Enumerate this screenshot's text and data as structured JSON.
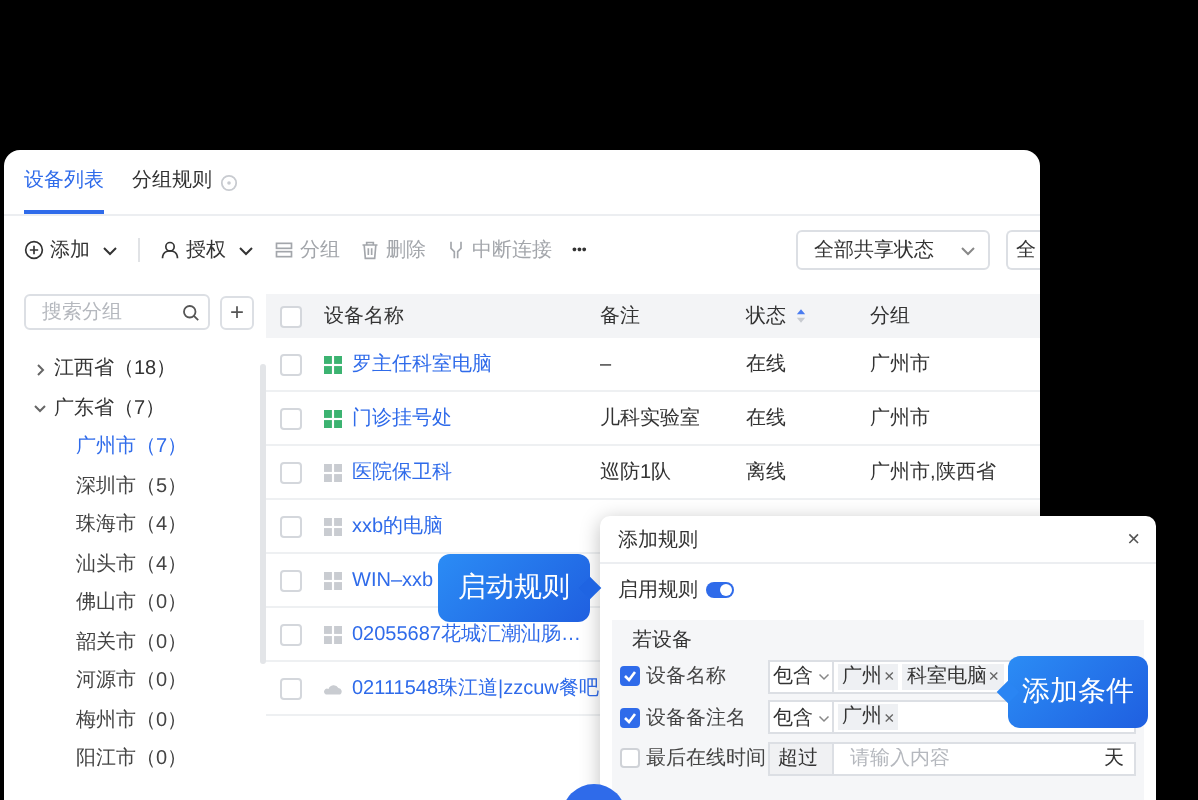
{
  "tabs": [
    {
      "label": "设备列表",
      "selected": true
    },
    {
      "label": "分组规则",
      "selected": false
    }
  ],
  "toolbar": [
    {
      "label": "添加",
      "kind": "add",
      "disabled": false,
      "caret": true
    },
    {
      "label": "授权",
      "kind": "user",
      "disabled": false,
      "caret": true
    },
    {
      "label": "分组",
      "kind": "group",
      "disabled": true,
      "caret": false
    },
    {
      "label": "删除",
      "kind": "delete",
      "disabled": true,
      "caret": false
    },
    {
      "label": "中断连接",
      "kind": "disconnect",
      "disabled": true,
      "caret": false
    },
    {
      "label": "•••",
      "kind": "more",
      "disabled": false,
      "caret": false
    }
  ],
  "filters": [
    "全部共享状态",
    "全"
  ],
  "sidebar": {
    "search_placeholder": "搜索分组",
    "add_label": "+",
    "tree": [
      {
        "label": "江西省（18）",
        "expanded": false
      },
      {
        "label": "广东省（7）",
        "expanded": true,
        "children": [
          {
            "label": "广州市（7）",
            "selected": true
          },
          {
            "label": "深圳市（5）",
            "selected": false
          },
          {
            "label": "珠海市（4）",
            "selected": false
          },
          {
            "label": "汕头市（4）",
            "selected": false
          },
          {
            "label": "佛山市（0）",
            "selected": false
          },
          {
            "label": "韶关市（0）",
            "selected": false
          },
          {
            "label": "河源市（0）",
            "selected": false
          },
          {
            "label": "梅州市（0）",
            "selected": false
          },
          {
            "label": "阳江市（0）",
            "selected": false
          }
        ]
      }
    ]
  },
  "table": {
    "all_selected": false,
    "columns": [
      "设备名称",
      "备注",
      "状态",
      "分组"
    ],
    "rows": [
      {
        "name": "罗主任科室电脑",
        "note": "–",
        "status": "在线",
        "group": "广州市",
        "kind": "online",
        "selected": false
      },
      {
        "name": "门诊挂号处",
        "note": "儿科实验室",
        "status": "在线",
        "group": "广州市",
        "kind": "online",
        "selected": false
      },
      {
        "name": "医院保卫科",
        "note": "巡防1队",
        "status": "离线",
        "group": "广州市,陕西省",
        "kind": "offline",
        "selected": false
      },
      {
        "name": "xxb的电脑",
        "kind": "offline",
        "selected": false
      },
      {
        "name": "WIN–xxb",
        "kind": "offline",
        "selected": false
      },
      {
        "name": "02055687花城汇潮汕肠…",
        "kind": "offline",
        "selected": false
      },
      {
        "name": "02111548珠江道|zzcuw餐吧",
        "kind": "cloud",
        "selected": false
      }
    ]
  },
  "dialog": {
    "title": "添加规则",
    "close": "×",
    "enable_label": "启用规则",
    "enabled": true,
    "section_title": "若设备",
    "conditions": [
      {
        "label": "设备名称",
        "checked": true,
        "kind": "tags",
        "operator": "包含",
        "tags": [
          {
            "label": "广州",
            "remove": "×"
          },
          {
            "label": "科室电脑",
            "remove": "×"
          }
        ]
      },
      {
        "label": "设备备注名",
        "checked": true,
        "kind": "tags",
        "operator": "包含",
        "tags": [
          {
            "label": "广州",
            "remove": "×"
          }
        ]
      },
      {
        "label": "最后在线时间",
        "checked": false,
        "kind": "input",
        "operator": "超过",
        "placeholder": "请输入内容",
        "unit": "天"
      }
    ]
  },
  "callouts": [
    "启动规则",
    "添加条件"
  ]
}
